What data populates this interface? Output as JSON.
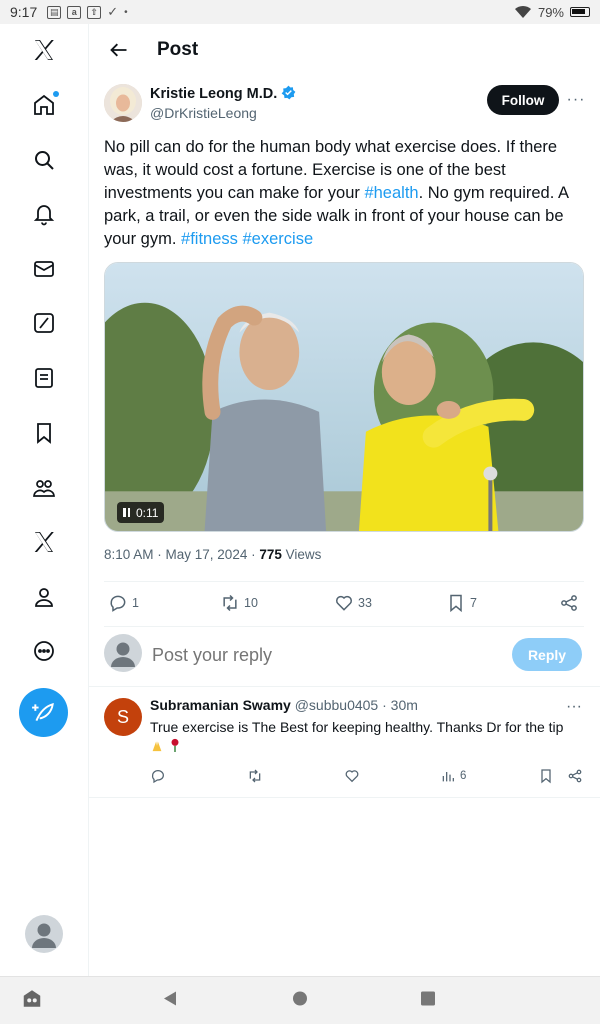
{
  "status_bar": {
    "time": "9:17",
    "battery": "79%"
  },
  "header": {
    "title": "Post"
  },
  "nav": {
    "items": [
      "x-logo",
      "home",
      "search",
      "notifications",
      "messages",
      "grok",
      "lists",
      "bookmarks",
      "communities",
      "premium",
      "profile",
      "more"
    ]
  },
  "post": {
    "author_name": "Kristie Leong M.D.",
    "author_handle": "@DrKristieLeong",
    "follow_label": "Follow",
    "more_label": "···",
    "text_1": "No pill can do for the human body what exercise does. If there was, it would cost a fortune. Exercise is one of the best investments you can make for your ",
    "tag_health": "#health",
    "text_2": ".  No gym required. A park, a trail, or even the side walk in front of your house can be your gym. ",
    "tag_fitness": "#fitness",
    "tag_exercise": "#exercise",
    "video_time": "0:11",
    "timestamp": "8:10 AM · May 17, 2024 · ",
    "views_count": "775",
    "views_label": " Views",
    "stats": {
      "replies": "1",
      "reposts": "10",
      "likes": "33",
      "bookmarks": "7"
    }
  },
  "composer": {
    "placeholder": "Post your reply",
    "reply_label": "Reply"
  },
  "reply": {
    "avatar_letter": "S",
    "name": "Subramanian Swamy",
    "handle": "@subbu0405",
    "time": " · 30m",
    "text": "True exercise is The Best for keeping healthy. Thanks Dr for the tip",
    "views": "6",
    "more_label": "···"
  },
  "colors": {
    "accent": "#1d9bf0",
    "text": "#0f1419",
    "muted": "#536471",
    "reply_disabled": "#8ecdf8"
  }
}
